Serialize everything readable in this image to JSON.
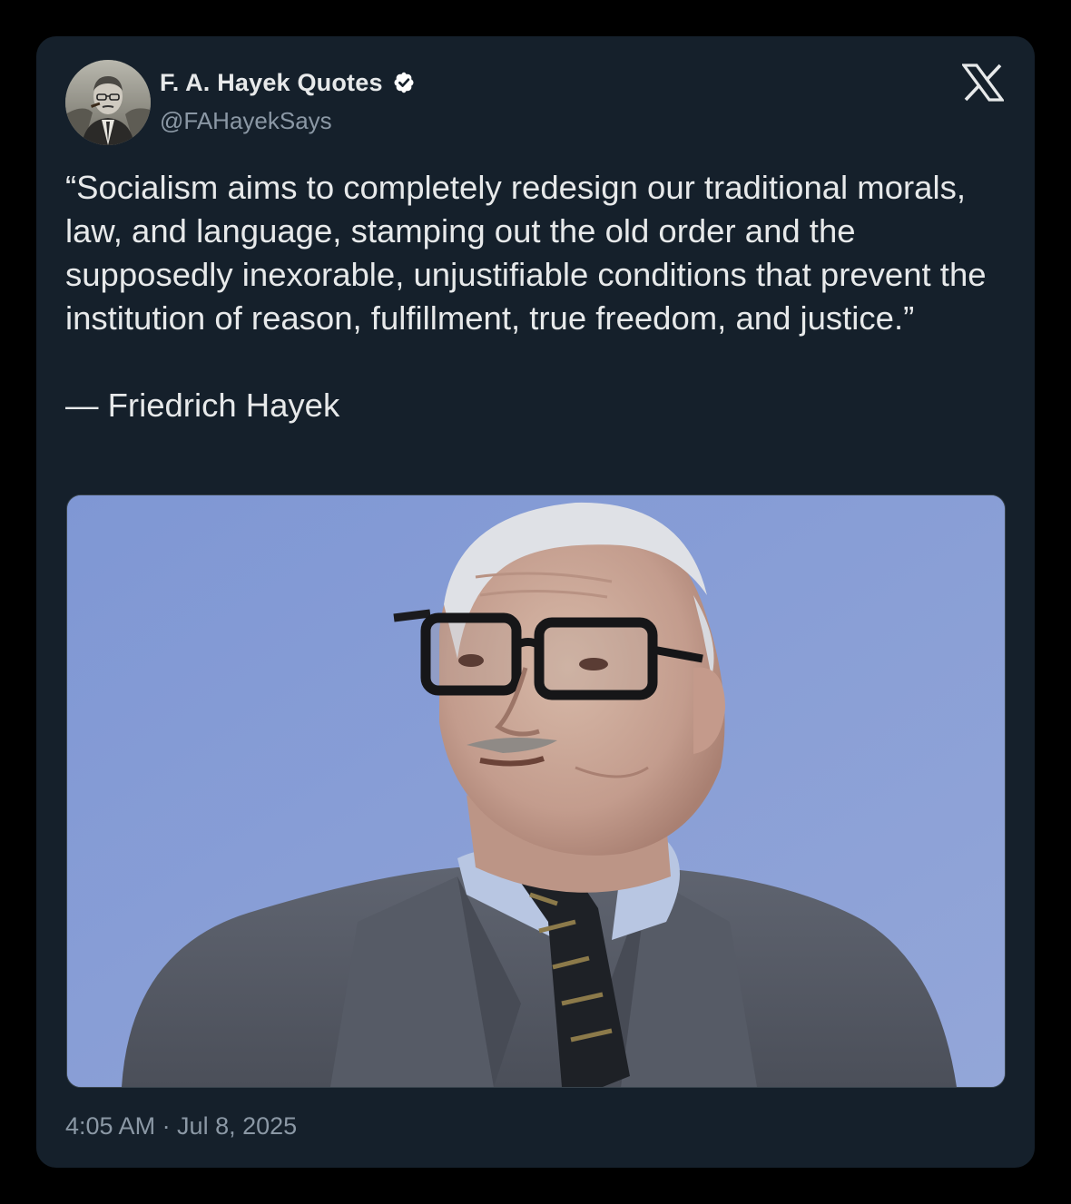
{
  "author": {
    "display_name": "F. A. Hayek Quotes",
    "handle": "@FAHayekSays",
    "verified": true,
    "avatar": "profile-photo-hayek"
  },
  "platform_icon": "x-logo-icon",
  "tweet": {
    "text": "“Socialism aims to completely redesign our traditional morals, law, and language, stamping out the old order and the supposedly inexorable, unjustifiable conditions that prevent the institution of reason, fulfillment, true freedom, and justice.”\n\n— Friedrich Hayek",
    "media": "photo-elderly-man-glasses-suit-blue-background"
  },
  "meta": {
    "time": "4:05 AM · Jul 8, 2025"
  },
  "colors": {
    "background": "#000000",
    "card": "#15202b",
    "primary_text": "#e7e9ea",
    "secondary_text": "#8b98a5",
    "verified_badge": "#ffffff"
  }
}
